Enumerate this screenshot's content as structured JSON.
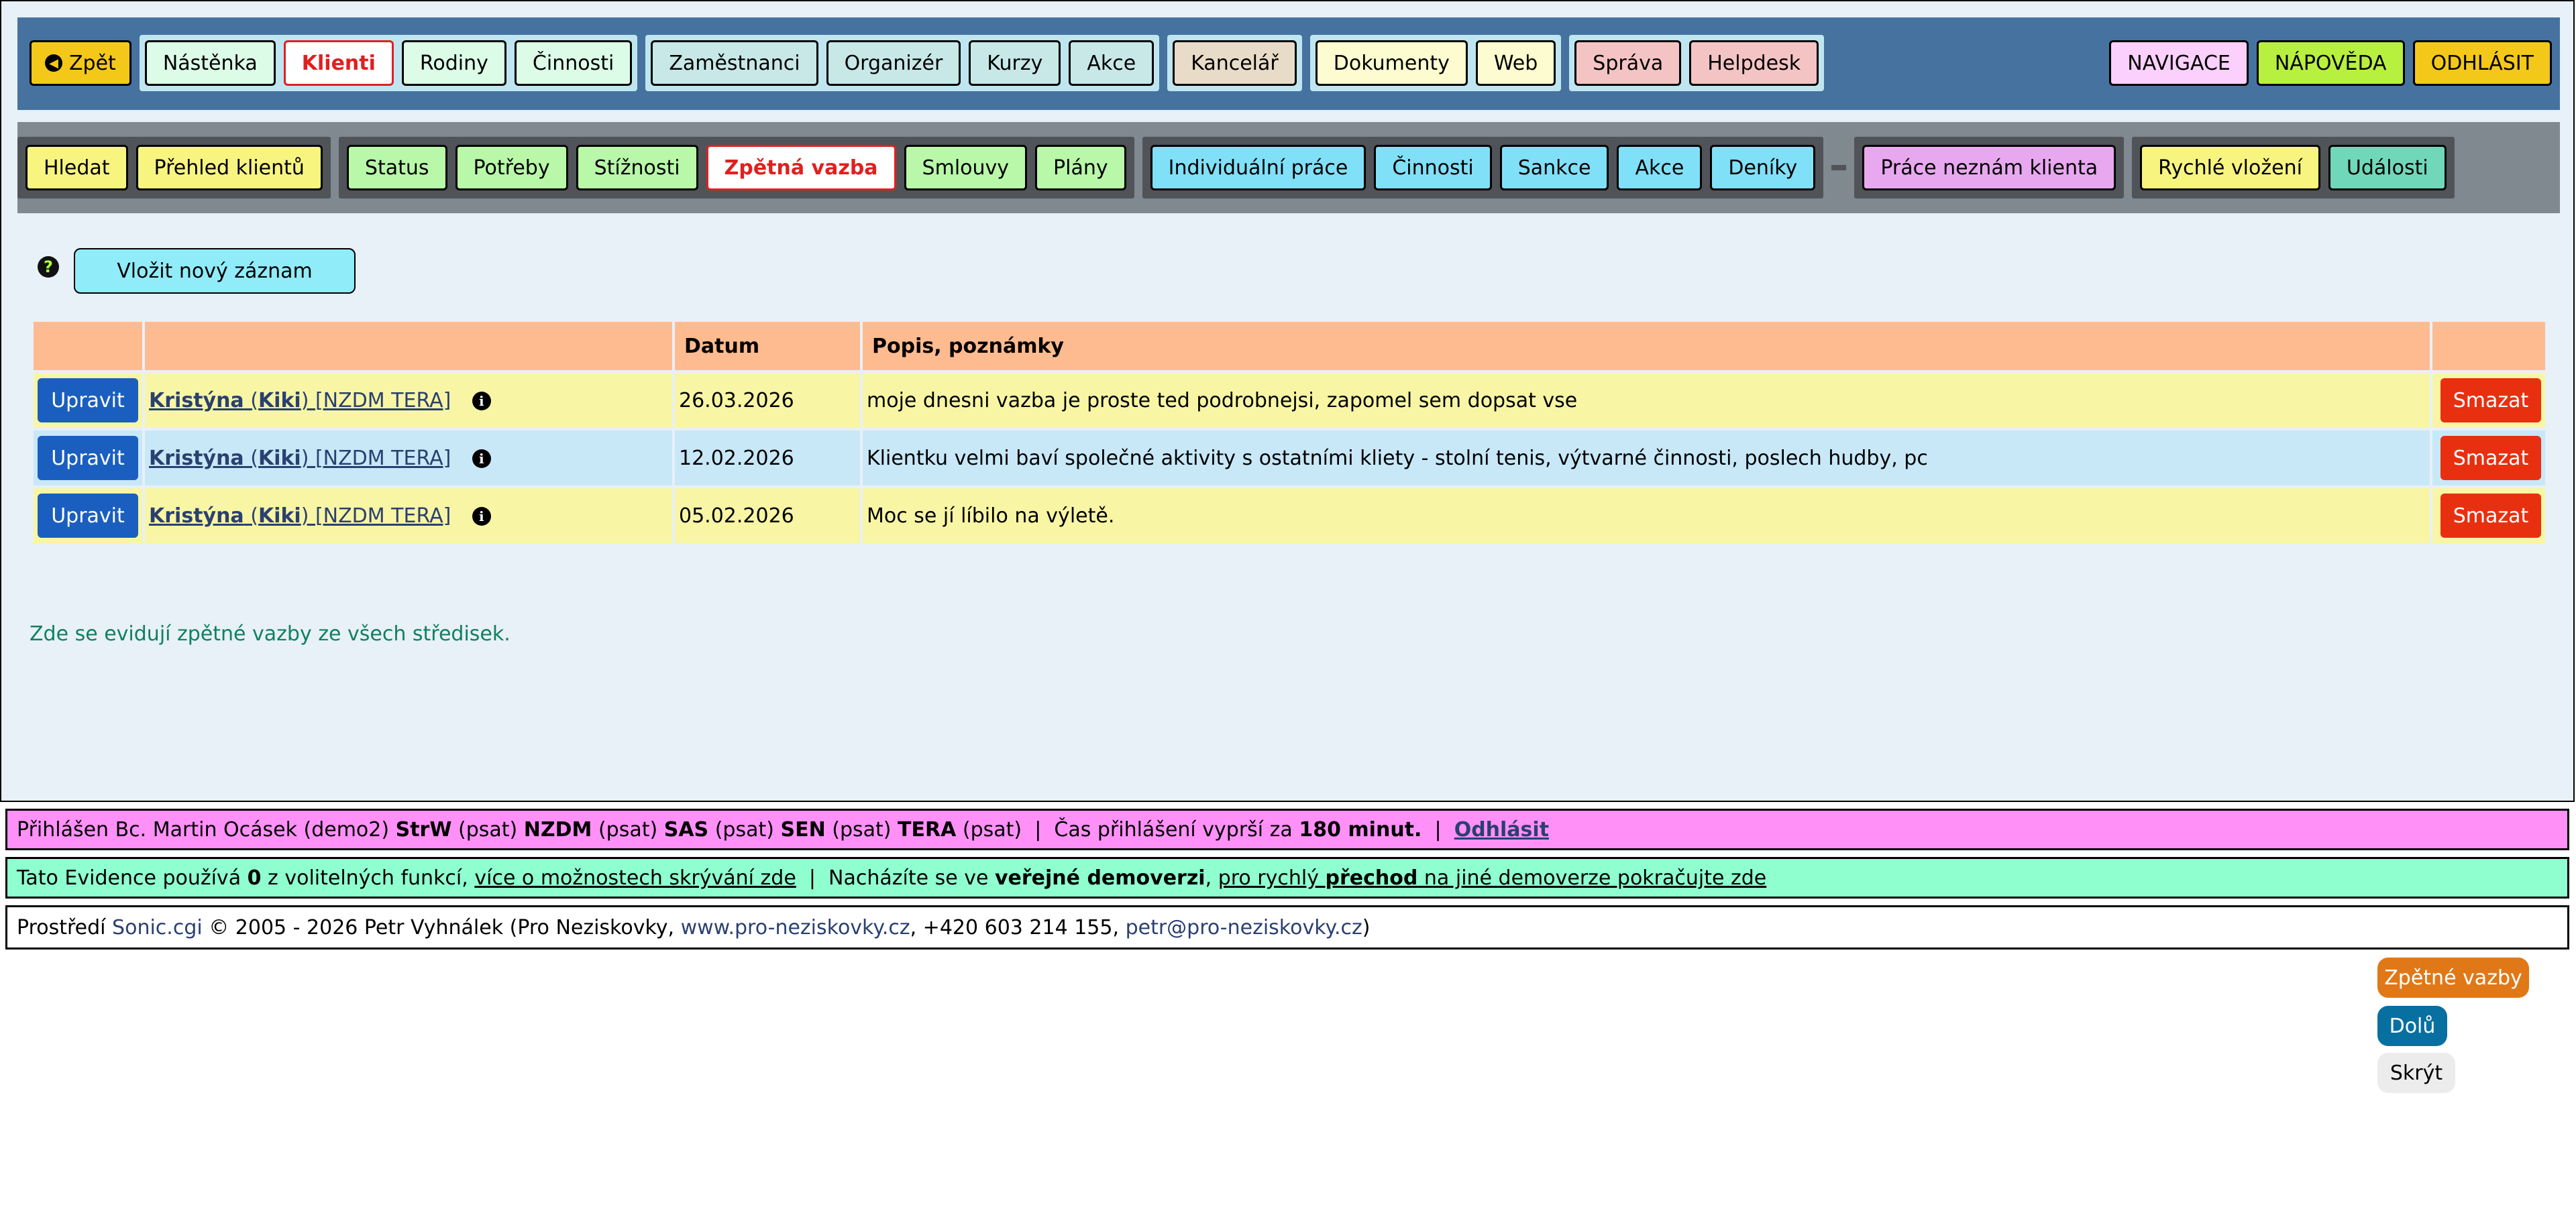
{
  "topnav": {
    "back": "Zpět",
    "group1": [
      "Nástěnka",
      "Klienti",
      "Rodiny",
      "Činnosti"
    ],
    "group2": [
      "Zaměstnanci",
      "Organizér",
      "Kurzy",
      "Akce"
    ],
    "group3": [
      "Kancelář"
    ],
    "group4": [
      "Dokumenty",
      "Web"
    ],
    "group5": [
      "Správa",
      "Helpdesk"
    ],
    "right": [
      "NAVIGACE",
      "NÁPOVĚDA",
      "ODHLÁSIT"
    ],
    "active": "Klienti"
  },
  "subnav": {
    "group1": [
      "Hledat",
      "Přehled klientů"
    ],
    "group2": [
      "Status",
      "Potřeby",
      "Stížnosti",
      "Zpětná vazba",
      "Smlouvy",
      "Plány"
    ],
    "group3": [
      "Individuální práce",
      "Činnosti",
      "Sankce",
      "Akce",
      "Deníky"
    ],
    "group4": [
      "Práce neznám klienta"
    ],
    "group5": [
      "Rychlé vložení",
      "Události"
    ],
    "active": "Zpětná vazba"
  },
  "add_button": "Vložit nový záznam",
  "table": {
    "headers": [
      "",
      "",
      "Datum",
      "Popis, poznámky",
      ""
    ],
    "rows": [
      {
        "edit": "Upravit",
        "name": "Kristýna",
        "nick": "Kiki",
        "tag": "[NZDM TERA]",
        "date": "26.03.2026",
        "note": "moje dnesni vazba je proste ted podrobnejsi, zapomel sem dopsat vse",
        "delete": "Smazat"
      },
      {
        "edit": "Upravit",
        "name": "Kristýna",
        "nick": "Kiki",
        "tag": "[NZDM TERA]",
        "date": "12.02.2026",
        "note": "Klientku velmi baví společné aktivity s ostatními kliety - stolní tenis, výtvarné činnosti, poslech hudby, pc",
        "delete": "Smazat"
      },
      {
        "edit": "Upravit",
        "name": "Kristýna",
        "nick": "Kiki",
        "tag": "[NZDM TERA]",
        "date": "05.02.2026",
        "note": "Moc se jí líbilo na výletě.",
        "delete": "Smazat"
      }
    ]
  },
  "note": "Zde se evidují zpětné vazby ze všech středisek.",
  "footer": {
    "login": {
      "prefix": "Přihlášen Bc. Martin Ocásek (demo2)",
      "r1": "StrW",
      "r1p": "(psat)",
      "r2": "NZDM",
      "r2p": "(psat)",
      "r3": "SAS",
      "r3p": "(psat)",
      "r4": "SEN",
      "r4p": "(psat)",
      "r5": "TERA",
      "r5p": "(psat)",
      "sep": "|",
      "expiry_prefix": "Čas přihlášení vyprší za",
      "expiry_value": "180 minut.",
      "logout": "Odhlásit"
    },
    "features": {
      "t1": "Tato Evidence používá",
      "count": "0",
      "t2": "z volitelných funkcí,",
      "link1": "více o možnostech skrývání zde",
      "sep": "|",
      "t3": "Nacházíte se ve",
      "bold": "veřejné demoverzi",
      "t4": ",",
      "link2a": "pro rychlý",
      "link2b": "přechod",
      "link2c": "na jiné demoverze pokračujte zde"
    },
    "credits": {
      "t1": "Prostředí",
      "product": "Sonic.cgi",
      "t2": "© 2005 - 2026 Petr Vyhnálek (Pro Neziskovky,",
      "website": "www.pro-neziskovky.cz",
      "t3": ", +420 603 214 155,",
      "email": "petr@pro-neziskovky.cz",
      "t4": ")"
    }
  },
  "floating": [
    "Zpětné vazby",
    "Dolů",
    "Skrýt"
  ],
  "colors": {
    "topnav_bg": "#4672a0",
    "subnav_bg": "#808890",
    "active_text": "#e02020",
    "header_bg": "#ffbb90"
  }
}
